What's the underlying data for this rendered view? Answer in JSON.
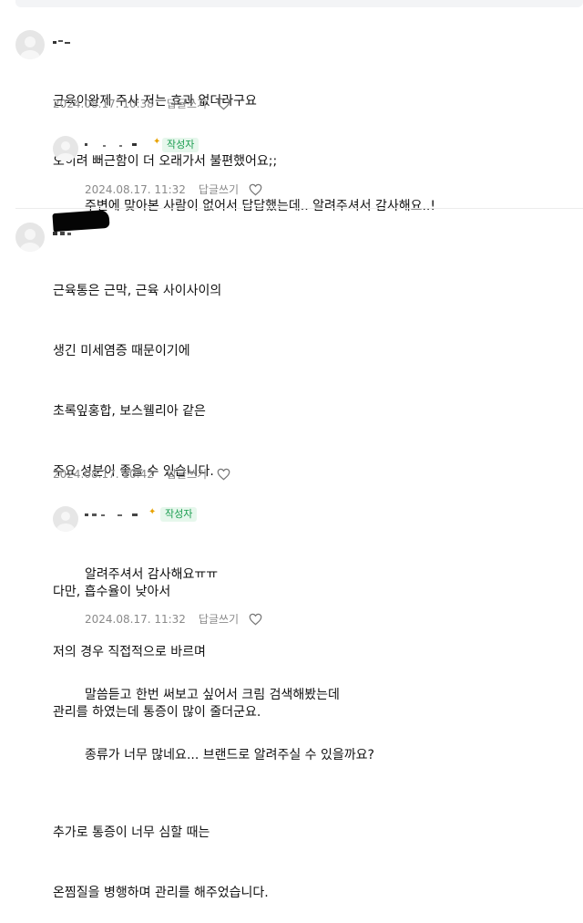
{
  "comments": [
    {
      "lines": [
        "근육이완제 주사 저는 효과 없더라구요",
        "오히려 뻐근함이 더 오래가서 불편했어요;;"
      ],
      "date": "2024.08.17. 10:38",
      "reply_label": "답글쓰기",
      "replies": [
        {
          "badge": "작성자",
          "lines": [
            "주변에 맞아본 사람이 없어서 답답했는데.. 알려주셔서 감사해요..!"
          ],
          "date": "2024.08.17. 11:32",
          "reply_label": "답글쓰기"
        }
      ]
    },
    {
      "lines": [
        "근육통은 근막, 근육 사이사이의",
        "생긴 미세염증 때문이기에",
        "초록잎홍합, 보스웰리아 같은",
        "주요 성분이 좋을 수 있습니다.",
        "",
        "다만, 흡수율이 낮아서",
        "저의 경우 직접적으로 바르며",
        "관리를 하였는데 통증이 많이 줄더군요.",
        "",
        "추가로 통증이 너무 심할 때는",
        "온찜질을 병행하며 관리를 해주었습니다."
      ],
      "date": "2024.08.17. 10:42",
      "reply_label": "답글쓰기",
      "replies": [
        {
          "badge": "작성자",
          "lines": [
            "알려주셔서 감사해요ㅠㅠ",
            "",
            "말씀듣고 한번 써보고 싶어서 크림 검색해봤는데",
            "종류가 너무 많네요... 브랜드로 알려주실 수 있을까요?"
          ],
          "date": "2024.08.17. 11:32",
          "reply_label": "답글쓰기"
        }
      ]
    }
  ],
  "icons": {
    "avatar": "default-user-icon",
    "like": "heart-outline-icon",
    "medal": "medal-icon"
  },
  "colors": {
    "badge_bg": "#e6f7ec",
    "badge_text": "#1a9c4f",
    "meta": "#8a8a8a"
  }
}
